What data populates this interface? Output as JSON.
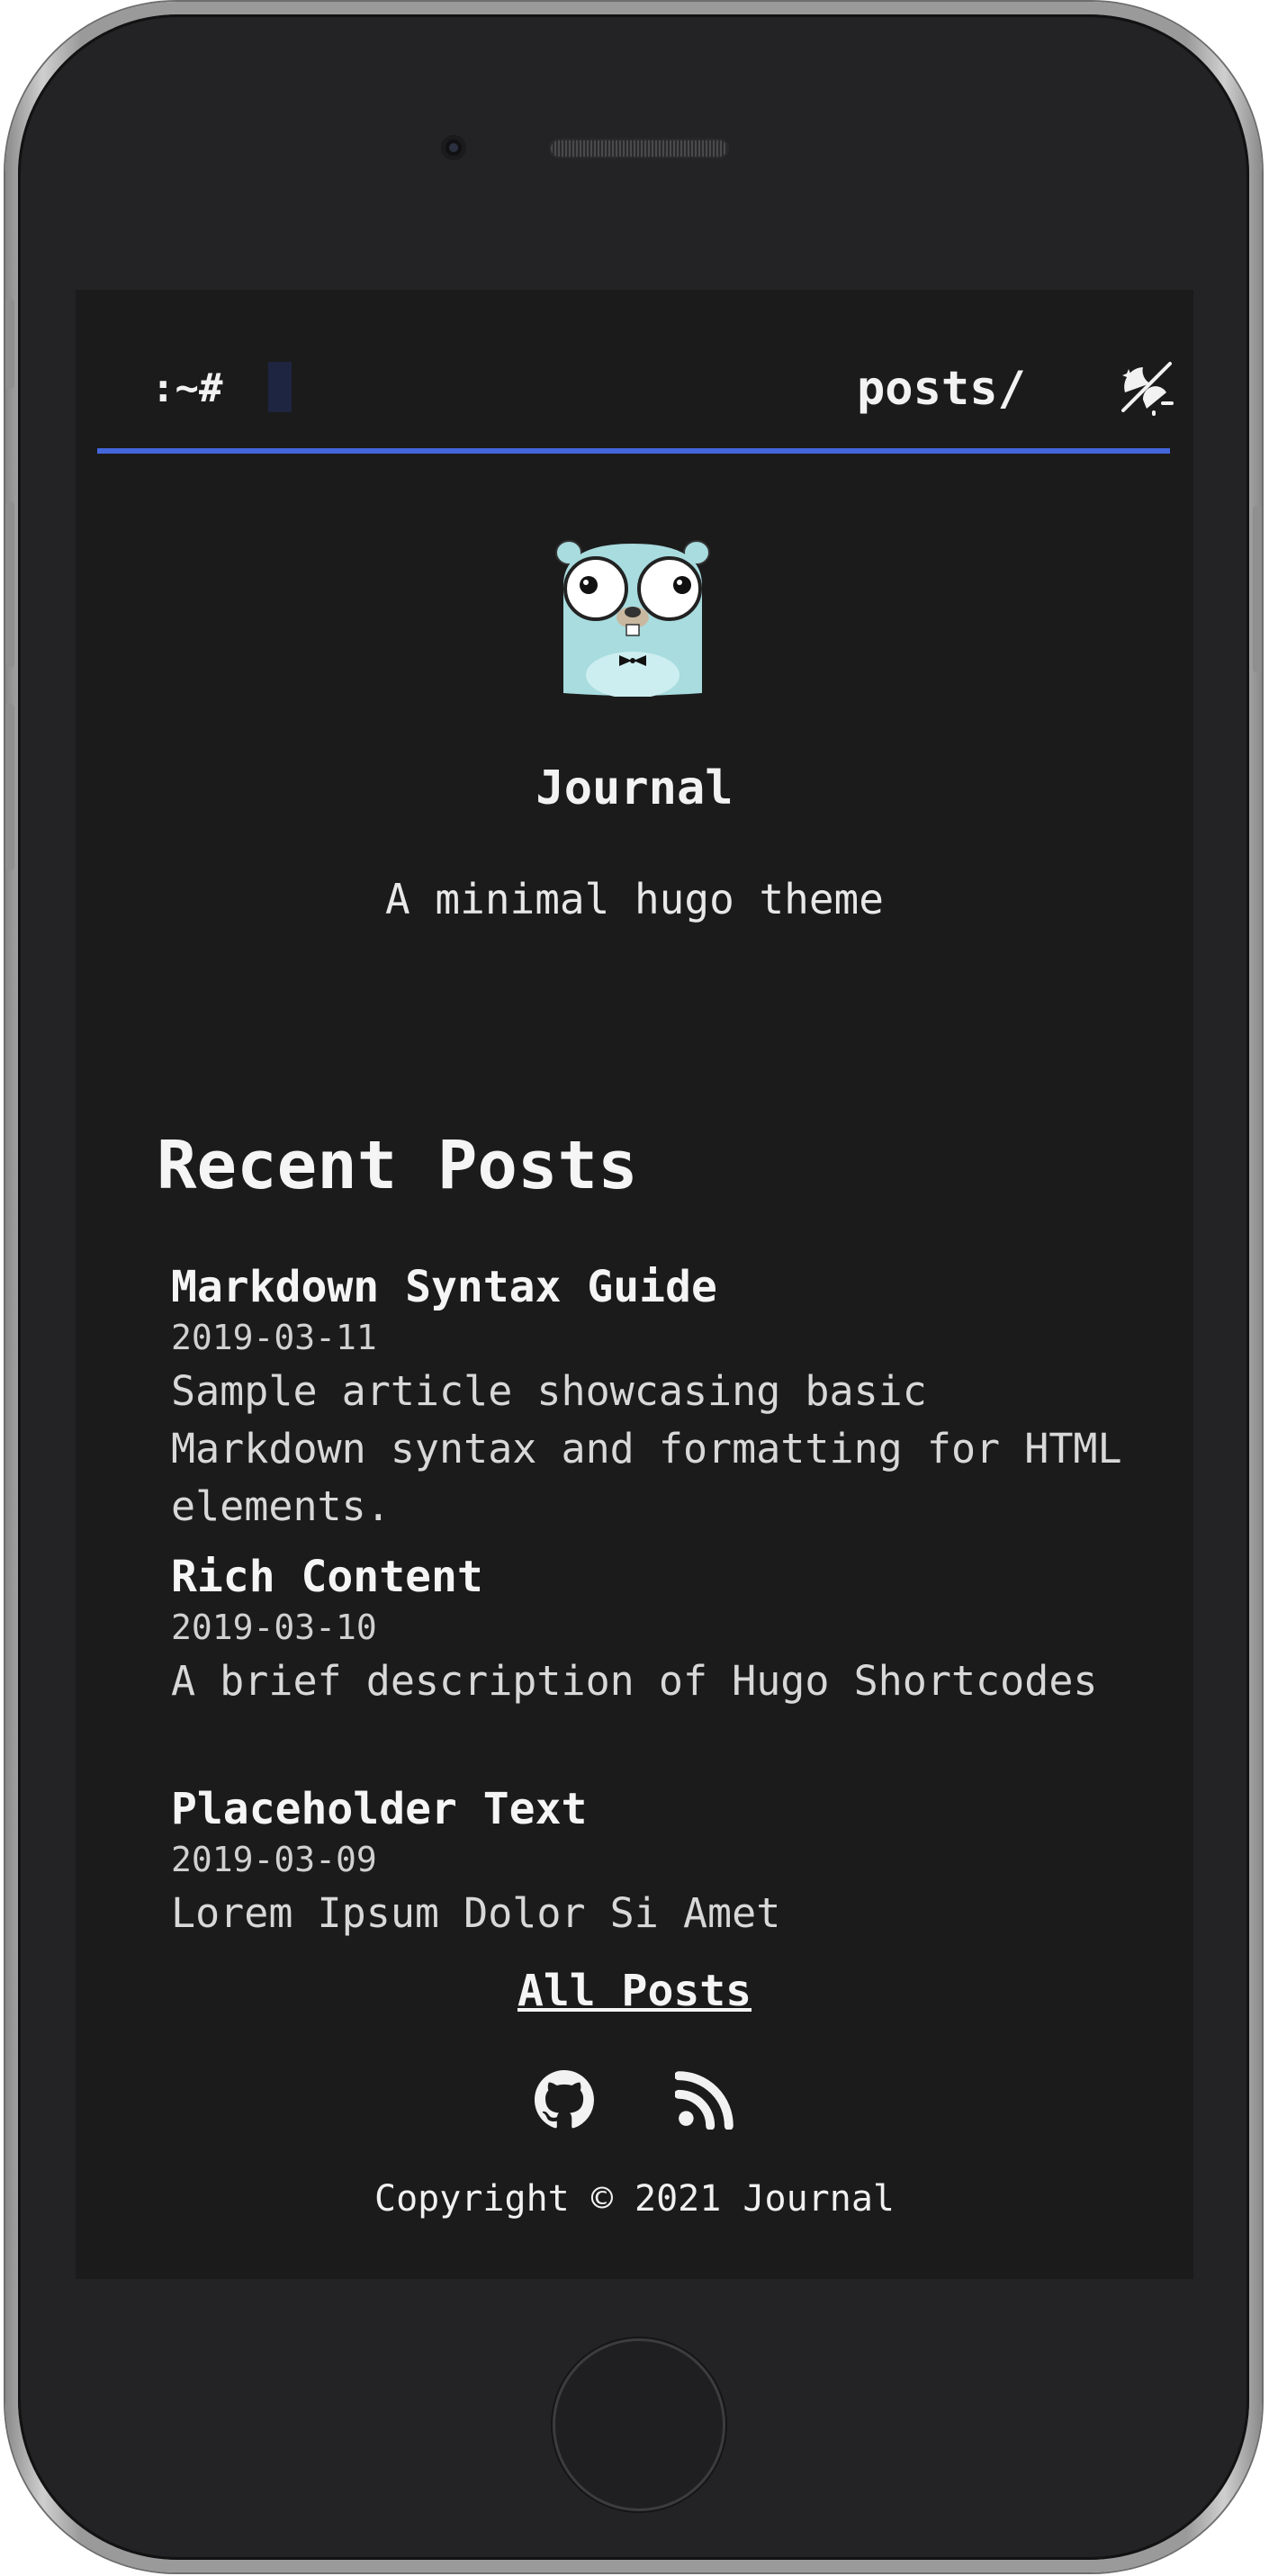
{
  "header": {
    "prompt": ":~#",
    "nav_link": "posts/",
    "theme_toggle_icon": "moon-sun-toggle-icon",
    "accent_color": "#4466dd"
  },
  "profile": {
    "avatar_icon": "gopher-avatar",
    "title": "Journal",
    "description": "A minimal hugo theme"
  },
  "recent": {
    "heading": "Recent Posts",
    "posts": [
      {
        "title": "Markdown Syntax Guide",
        "date": "2019-03-11",
        "summary": "Sample article showcasing basic Markdown syntax and formatting for HTML elements."
      },
      {
        "title": "Rich Content",
        "date": "2019-03-10",
        "summary": "A brief description of Hugo Shortcodes"
      },
      {
        "title": "Placeholder Text",
        "date": "2019-03-09",
        "summary": "Lorem Ipsum Dolor Si Amet"
      }
    ],
    "all_posts_label": "All Posts"
  },
  "footer": {
    "social_icons": [
      "github-icon",
      "rss-icon"
    ],
    "copyright": "Copyright © 2021 Journal"
  },
  "colors": {
    "background": "#1b1b1b",
    "text": "#f2f2f2",
    "accent": "#4466dd"
  }
}
